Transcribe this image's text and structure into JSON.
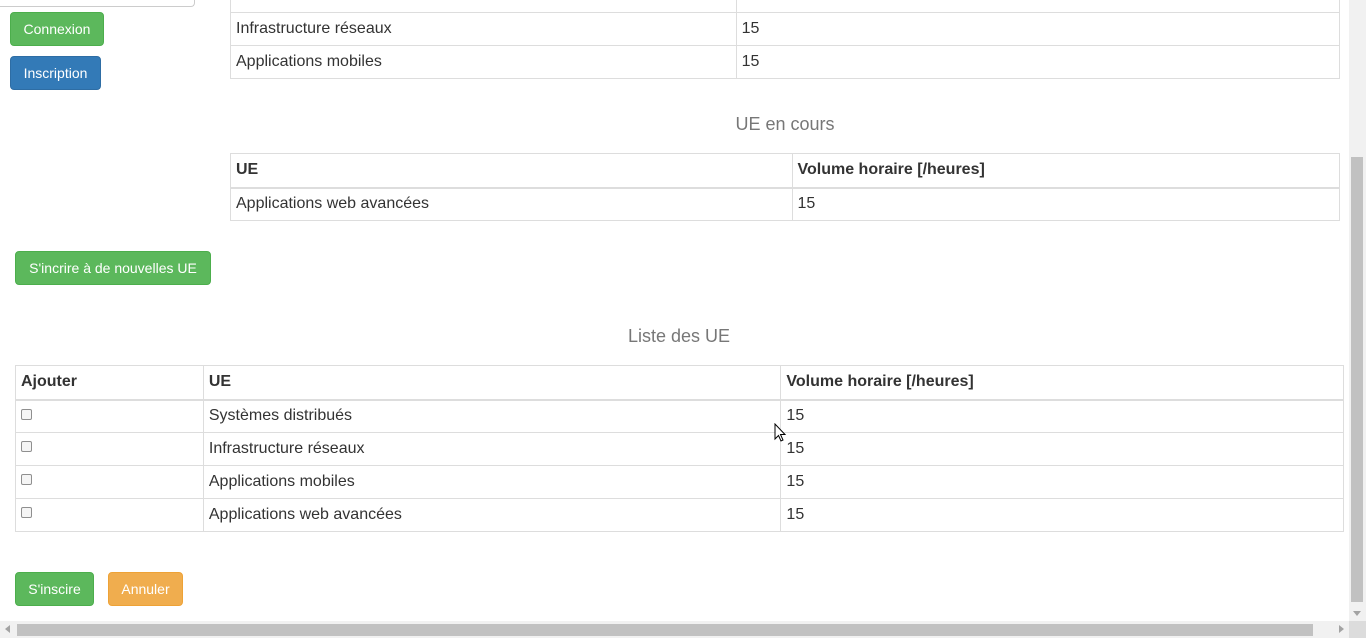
{
  "sidebar": {
    "login_label": "Connexion",
    "register_label": "Inscription"
  },
  "top_table": {
    "rows": [
      {
        "ue": "Infrastructure réseaux",
        "volume": "15"
      },
      {
        "ue": "Applications mobiles",
        "volume": "15"
      }
    ]
  },
  "current_section": {
    "title": "UE en cours",
    "headers": {
      "ue": "UE",
      "volume": "Volume horaire [/heures]"
    },
    "rows": [
      {
        "ue": "Applications web avancées",
        "volume": "15"
      }
    ]
  },
  "enroll_new_label": "S'incrire à de nouvelles UE",
  "list_section": {
    "title": "Liste des UE",
    "headers": {
      "add": "Ajouter",
      "ue": "UE",
      "volume": "Volume horaire [/heures]"
    },
    "rows": [
      {
        "ue": "Systèmes distribués",
        "volume": "15"
      },
      {
        "ue": "Infrastructure réseaux",
        "volume": "15"
      },
      {
        "ue": "Applications mobiles",
        "volume": "15"
      },
      {
        "ue": "Applications web avancées",
        "volume": "15"
      }
    ]
  },
  "actions": {
    "submit_label": "S'inscire",
    "cancel_label": "Annuler"
  },
  "colors": {
    "success": "#5cb85c",
    "primary": "#337ab7",
    "warning": "#f0ad4e"
  }
}
